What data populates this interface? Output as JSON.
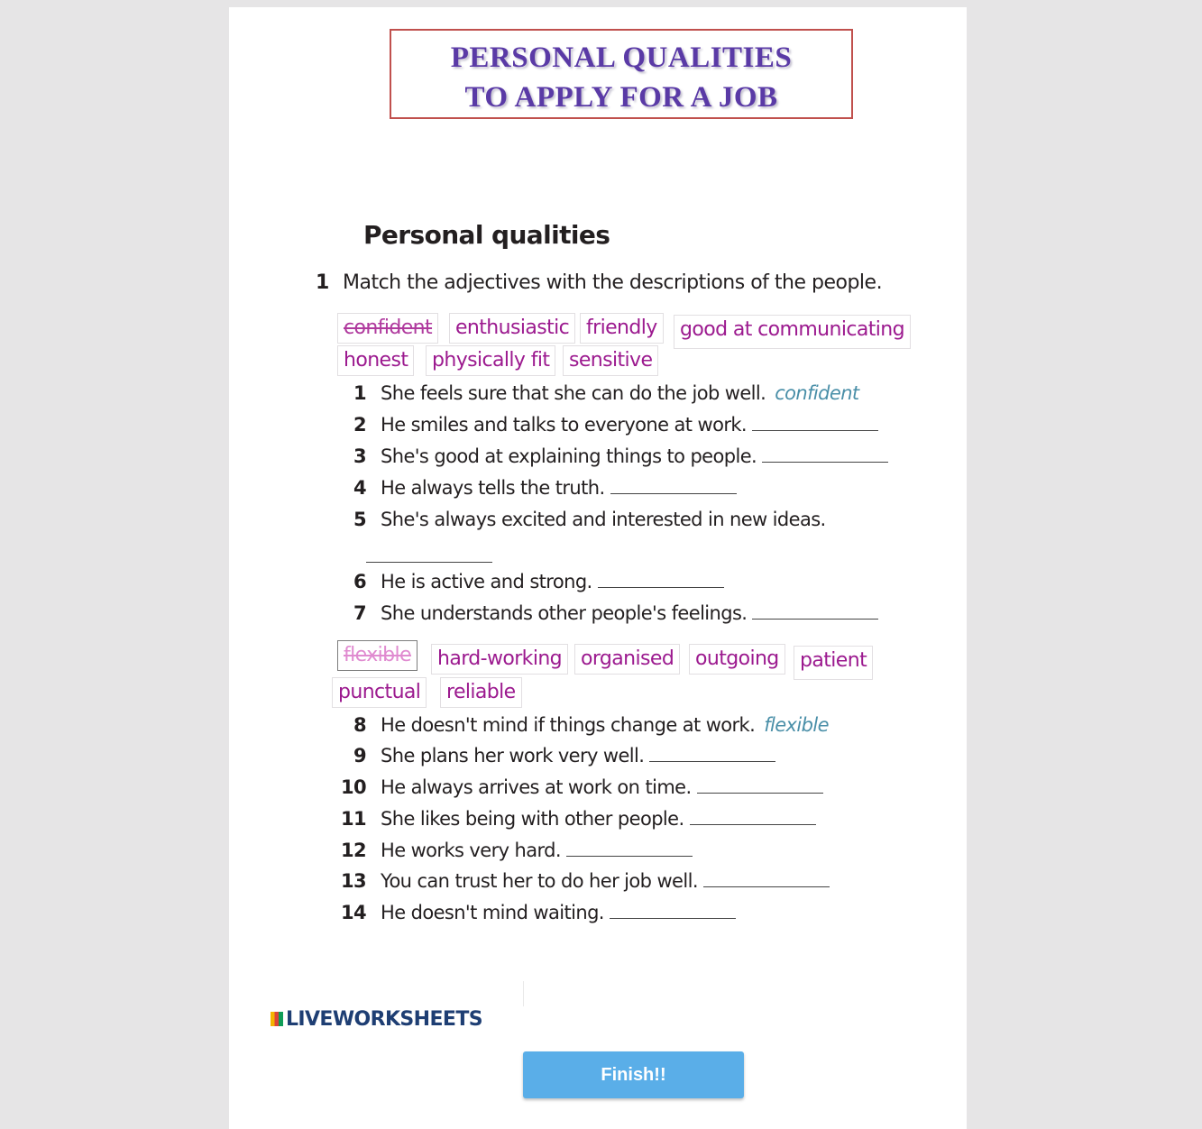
{
  "title": {
    "line1": "PERSONAL QUALITIES",
    "line2": "TO APPLY FOR A JOB"
  },
  "section": {
    "heading": "Personal qualities"
  },
  "instruction": {
    "number": "1",
    "text": "Match the adjectives with the descriptions of the people."
  },
  "bank1": [
    "confident",
    "enthusiastic",
    "friendly",
    "good at communicating",
    "honest",
    "physically fit",
    "sensitive"
  ],
  "bank2": [
    "flexible",
    "hard-working",
    "organised",
    "outgoing",
    "patient",
    "punctual",
    "reliable"
  ],
  "items": [
    {
      "n": "1",
      "text": "She feels sure that she can do the job well.",
      "answer": "confident"
    },
    {
      "n": "2",
      "text": "He smiles and talks to everyone at work."
    },
    {
      "n": "3",
      "text": "She's good at explaining things to people."
    },
    {
      "n": "4",
      "text": "He always tells the truth."
    },
    {
      "n": "5",
      "text": "She's always excited and interested in new ideas."
    },
    {
      "n": "6",
      "text": "He is active and strong."
    },
    {
      "n": "7",
      "text": "She understands other people's feelings."
    },
    {
      "n": "8",
      "text": "He doesn't mind if things change at work.",
      "answer": "flexible"
    },
    {
      "n": "9",
      "text": "She plans her work very well."
    },
    {
      "n": "10",
      "text": "He always arrives at work on time."
    },
    {
      "n": "11",
      "text": "She likes being with other people."
    },
    {
      "n": "12",
      "text": "He works very hard."
    },
    {
      "n": "13",
      "text": "You can trust her to do her job well."
    },
    {
      "n": "14",
      "text": "He doesn't mind waiting."
    }
  ],
  "footer": {
    "logo": "LIVEWORKSHEETS",
    "finish_label": "Finish!!"
  }
}
